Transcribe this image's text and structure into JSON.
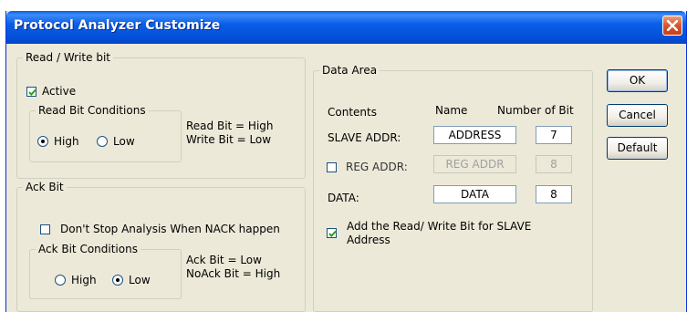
{
  "window": {
    "title": "Protocol Analyzer Customize"
  },
  "rw_group": {
    "legend": "Read / Write bit",
    "active_label": "Active",
    "active_checked": true,
    "conditions_legend": "Read Bit Conditions",
    "high_label": "High",
    "low_label": "Low",
    "selected": "High",
    "info_line1": "Read Bit = High",
    "info_line2": "Write Bit = Low"
  },
  "ack_group": {
    "legend": "Ack Bit",
    "dont_stop_label": "Don't Stop Analysis When NACK happen",
    "dont_stop_checked": false,
    "conditions_legend": "Ack Bit Conditions",
    "high_label": "High",
    "low_label": "Low",
    "selected": "Low",
    "info_line1": "Ack Bit = Low",
    "info_line2": "NoAck Bit = High"
  },
  "data_area": {
    "legend": "Data Area",
    "col_contents": "Contents",
    "col_name": "Name",
    "col_bits": "Number of Bit",
    "slave_label": "SLAVE ADDR:",
    "slave_name": "ADDRESS",
    "slave_bits": "7",
    "reg_label": "REG ADDR:",
    "reg_checked": false,
    "reg_name": "REG ADDR",
    "reg_bits": "8",
    "data_label": "DATA:",
    "data_name": "DATA",
    "data_bits": "8",
    "add_rw_line1": "Add the Read/ Write Bit for SLAVE",
    "add_rw_line2": "Address",
    "add_rw_checked": true
  },
  "buttons": {
    "ok": "OK",
    "cancel": "Cancel",
    "default": "Default"
  }
}
